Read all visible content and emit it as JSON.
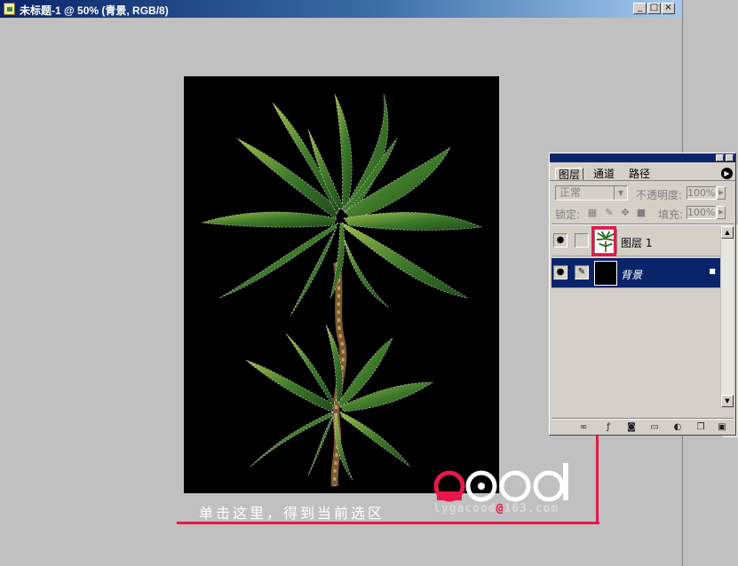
{
  "window": {
    "title": "未标题-1 @ 50% (青景, RGB/8)",
    "minimize_glyph": "_",
    "maximize_glyph": "□",
    "close_glyph": "×"
  },
  "caption": "单击这里，得到当前选区",
  "watermark": {
    "logo_text": "good",
    "email_user": "lygacood",
    "email_at": "@",
    "email_domain": "163.com"
  },
  "layers_panel": {
    "tabs": [
      "图层",
      "通道",
      "路径"
    ],
    "active_tab": "图层",
    "blend_mode": "正常",
    "opacity_label": "不透明度:",
    "opacity_value": "100%",
    "lock_label": "锁定:",
    "fill_label": "填充:",
    "fill_value": "100%",
    "layers": [
      {
        "name": "图层 1",
        "visible": true,
        "selected": false,
        "thumbnail": "palm-tree"
      },
      {
        "name": "背景",
        "visible": true,
        "selected": true,
        "thumbnail": "black",
        "locked": true
      }
    ],
    "bottom_icons": [
      "link-layers-icon",
      "add-style-icon",
      "add-mask-icon",
      "new-group-icon",
      "adjustment-layer-icon",
      "new-layer-icon",
      "delete-layer-icon"
    ]
  },
  "colors": {
    "accent": "#e8174a",
    "titlebar": "#0a246a",
    "canvas": "#000000",
    "workspace": "#c0c0c0"
  }
}
